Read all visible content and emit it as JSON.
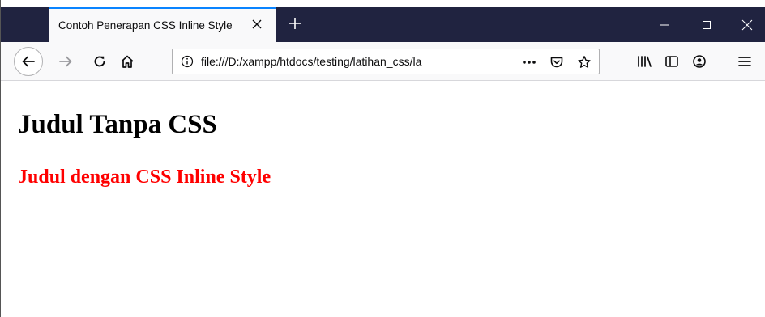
{
  "tab": {
    "title": "Contoh Penerapan CSS Inline Style"
  },
  "toolbar": {
    "url": "file:///D:/xampp/htdocs/testing/latihan_css/la",
    "more_label": "•••"
  },
  "page": {
    "heading_plain": "Judul Tanpa CSS",
    "heading_styled": "Judul dengan CSS Inline Style",
    "heading_styled_color": "#ff0000"
  },
  "colors": {
    "titlebar": "#202340",
    "tab_accent": "#0a84ff"
  }
}
